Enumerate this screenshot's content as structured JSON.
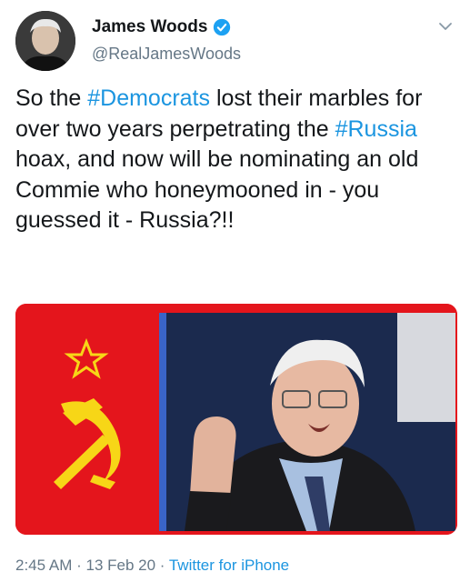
{
  "user": {
    "name": "James Woods",
    "handle": "@RealJamesWoods"
  },
  "tweet": {
    "text_1": "So the ",
    "hashtag_1": "#Democrats",
    "text_2": " lost their marbles for over two years perpetrating the ",
    "hashtag_2": "#Russia",
    "text_3": " hoax, and now will be nominating an old Commie who honeymooned in - you guessed it - Russia?!!"
  },
  "meta": {
    "time": "2:45 AM",
    "sep1": " · ",
    "date": "13 Feb 20",
    "sep2": " · ",
    "source": "Twitter for iPhone"
  },
  "colors": {
    "hashtag": "#1b95e0",
    "secondary_text": "#657786",
    "flag_red": "#e4151c",
    "flag_gold": "#f7d617"
  },
  "icons": [
    "verified-badge-icon",
    "chevron-down-icon",
    "hammer-sickle-icon",
    "star-icon"
  ]
}
